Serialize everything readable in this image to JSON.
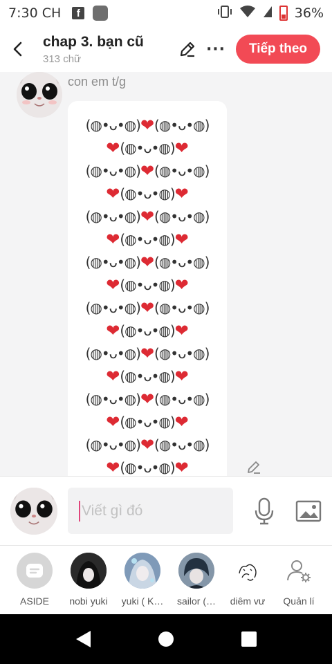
{
  "status_bar": {
    "time": "7:30 CH",
    "battery": "36%"
  },
  "header": {
    "title": "chap 3. bạn cũ",
    "subtitle": "313 chữ",
    "more_label": "···",
    "next_button": "Tiếp theo"
  },
  "message": {
    "sender": "con em t/g",
    "lines": [
      [
        "(◍•ᴗ•◍)",
        "❤",
        "(◍•ᴗ•◍)"
      ],
      [
        "❤",
        "(◍•ᴗ•◍)",
        "❤"
      ],
      [
        "(◍•ᴗ•◍)",
        "❤",
        "(◍•ᴗ•◍)"
      ],
      [
        "❤",
        "(◍•ᴗ•◍)",
        "❤"
      ],
      [
        "(◍•ᴗ•◍)",
        "❤",
        "(◍•ᴗ•◍)"
      ],
      [
        "❤",
        "(◍•ᴗ•◍)",
        "❤"
      ],
      [
        "(◍•ᴗ•◍)",
        "❤",
        "(◍•ᴗ•◍)"
      ],
      [
        "❤",
        "(◍•ᴗ•◍)",
        "❤"
      ],
      [
        "(◍•ᴗ•◍)",
        "❤",
        "(◍•ᴗ•◍)"
      ],
      [
        "❤",
        "(◍•ᴗ•◍)",
        "❤"
      ],
      [
        "(◍•ᴗ•◍)",
        "❤",
        "(◍•ᴗ•◍)"
      ],
      [
        "❤",
        "(◍•ᴗ•◍)",
        "❤"
      ],
      [
        "(◍•ᴗ•◍)",
        "❤",
        "(◍•ᴗ•◍)"
      ],
      [
        "❤",
        "(◍•ᴗ•◍)",
        "❤"
      ],
      [
        "(◍•ᴗ•◍)",
        "❤",
        "(◍•ᴗ•◍)"
      ],
      [
        "❤",
        "(◍•ᴗ•◍)",
        "❤"
      ]
    ]
  },
  "composer": {
    "placeholder": "Viết gì đó"
  },
  "members": [
    {
      "label": "ASIDE",
      "icon": "aside-icon"
    },
    {
      "label": "nobi yuki",
      "icon": "avatar"
    },
    {
      "label": "yuki ( K…",
      "icon": "avatar"
    },
    {
      "label": "sailor (…",
      "icon": "avatar"
    },
    {
      "label": "diêm vư",
      "icon": "avatar"
    },
    {
      "label": "Quản lí",
      "icon": "manage-users-icon"
    }
  ],
  "colors": {
    "accent": "#f24a55",
    "heart": "#dd2a33",
    "chat_background": "#f4f4f5"
  }
}
